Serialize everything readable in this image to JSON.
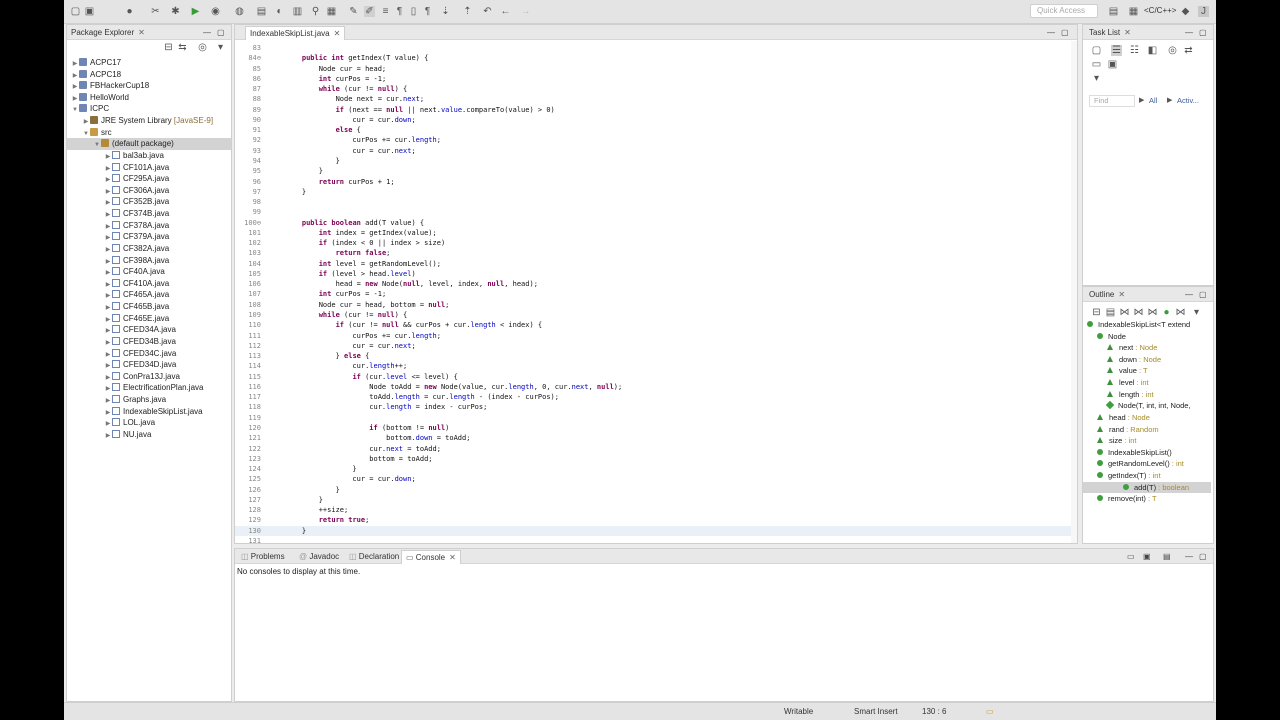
{
  "toolbar": {
    "quick_access_placeholder": "Quick Access",
    "perspective_label": "<C/C++>"
  },
  "package_explorer": {
    "tab_label": "Package Explorer",
    "tree": [
      {
        "label": "ACPC17",
        "level": 0,
        "icon": "project",
        "expander": "collapsed"
      },
      {
        "label": "ACPC18",
        "level": 0,
        "icon": "project",
        "expander": "collapsed"
      },
      {
        "label": "FBHackerCup18",
        "level": 0,
        "icon": "project",
        "expander": "collapsed"
      },
      {
        "label": "HelloWorld",
        "level": 0,
        "icon": "project",
        "expander": "collapsed"
      },
      {
        "label": "ICPC",
        "level": 0,
        "icon": "project",
        "expander": "expanded"
      },
      {
        "label": "JRE System Library",
        "extra": "[JavaSE-9]",
        "level": 1,
        "icon": "lib",
        "expander": "collapsed"
      },
      {
        "label": "src",
        "level": 1,
        "icon": "src",
        "expander": "expanded"
      },
      {
        "label": "(default package)",
        "level": 2,
        "icon": "pkg",
        "expander": "expanded",
        "selected": true
      },
      {
        "label": "bal3ab.java",
        "level": 3,
        "icon": "java",
        "expander": "collapsed"
      },
      {
        "label": "CF101A.java",
        "level": 3,
        "icon": "java",
        "expander": "collapsed"
      },
      {
        "label": "CF295A.java",
        "level": 3,
        "icon": "java",
        "expander": "collapsed"
      },
      {
        "label": "CF306A.java",
        "level": 3,
        "icon": "java",
        "expander": "collapsed"
      },
      {
        "label": "CF352B.java",
        "level": 3,
        "icon": "java",
        "expander": "collapsed"
      },
      {
        "label": "CF374B.java",
        "level": 3,
        "icon": "java",
        "expander": "collapsed"
      },
      {
        "label": "CF378A.java",
        "level": 3,
        "icon": "java",
        "expander": "collapsed"
      },
      {
        "label": "CF379A.java",
        "level": 3,
        "icon": "java",
        "expander": "collapsed"
      },
      {
        "label": "CF382A.java",
        "level": 3,
        "icon": "java",
        "expander": "collapsed"
      },
      {
        "label": "CF398A.java",
        "level": 3,
        "icon": "java",
        "expander": "collapsed"
      },
      {
        "label": "CF40A.java",
        "level": 3,
        "icon": "java",
        "expander": "collapsed"
      },
      {
        "label": "CF410A.java",
        "level": 3,
        "icon": "java",
        "expander": "collapsed"
      },
      {
        "label": "CF465A.java",
        "level": 3,
        "icon": "java",
        "expander": "collapsed"
      },
      {
        "label": "CF465B.java",
        "level": 3,
        "icon": "java",
        "expander": "collapsed"
      },
      {
        "label": "CF465E.java",
        "level": 3,
        "icon": "java",
        "expander": "collapsed"
      },
      {
        "label": "CFED34A.java",
        "level": 3,
        "icon": "java",
        "expander": "collapsed"
      },
      {
        "label": "CFED34B.java",
        "level": 3,
        "icon": "java",
        "expander": "collapsed"
      },
      {
        "label": "CFED34C.java",
        "level": 3,
        "icon": "java",
        "expander": "collapsed"
      },
      {
        "label": "CFED34D.java",
        "level": 3,
        "icon": "java",
        "expander": "collapsed"
      },
      {
        "label": "ConPra13J.java",
        "level": 3,
        "icon": "java",
        "expander": "collapsed"
      },
      {
        "label": "ElectrificationPlan.java",
        "level": 3,
        "icon": "java",
        "expander": "collapsed"
      },
      {
        "label": "Graphs.java",
        "level": 3,
        "icon": "java",
        "expander": "collapsed"
      },
      {
        "label": "IndexableSkipList.java",
        "level": 3,
        "icon": "java",
        "expander": "collapsed"
      },
      {
        "label": "LOL.java",
        "level": 3,
        "icon": "java",
        "expander": "collapsed"
      },
      {
        "label": "NU.java",
        "level": 3,
        "icon": "java",
        "expander": "collapsed"
      }
    ]
  },
  "editor": {
    "tab_label": "IndexableSkipList.java",
    "lines": [
      {
        "n": "83",
        "code": ""
      },
      {
        "n": "84⊖",
        "code": "    public int getIndex(T value) {"
      },
      {
        "n": "85",
        "code": "        Node cur = head;"
      },
      {
        "n": "86",
        "code": "        int curPos = -1;"
      },
      {
        "n": "87",
        "code": "        while (cur != null) {"
      },
      {
        "n": "88",
        "code": "            Node next = cur.next;"
      },
      {
        "n": "89",
        "code": "            if (next == null || next.value.compareTo(value) > 0)"
      },
      {
        "n": "90",
        "code": "                cur = cur.down;"
      },
      {
        "n": "91",
        "code": "            else {"
      },
      {
        "n": "92",
        "code": "                curPos += cur.length;"
      },
      {
        "n": "93",
        "code": "                cur = cur.next;"
      },
      {
        "n": "94",
        "code": "            }"
      },
      {
        "n": "95",
        "code": "        }"
      },
      {
        "n": "96",
        "code": "        return curPos + 1;"
      },
      {
        "n": "97",
        "code": "    }"
      },
      {
        "n": "98",
        "code": ""
      },
      {
        "n": "99",
        "code": ""
      },
      {
        "n": "100⊖",
        "code": "    public boolean add(T value) {"
      },
      {
        "n": "101",
        "code": "        int index = getIndex(value);"
      },
      {
        "n": "102",
        "code": "        if (index < 0 || index > size)"
      },
      {
        "n": "103",
        "code": "            return false;"
      },
      {
        "n": "104",
        "code": "        int level = getRandomLevel();"
      },
      {
        "n": "105",
        "code": "        if (level > head.level)"
      },
      {
        "n": "106",
        "code": "            head = new Node(null, level, index, null, head);"
      },
      {
        "n": "107",
        "code": "        int curPos = -1;"
      },
      {
        "n": "108",
        "code": "        Node cur = head, bottom = null;"
      },
      {
        "n": "109",
        "code": "        while (cur != null) {"
      },
      {
        "n": "110",
        "code": "            if (cur != null && curPos + cur.length < index) {"
      },
      {
        "n": "111",
        "code": "                curPos += cur.length;"
      },
      {
        "n": "112",
        "code": "                cur = cur.next;"
      },
      {
        "n": "113",
        "code": "            } else {"
      },
      {
        "n": "114",
        "code": "                cur.length++;"
      },
      {
        "n": "115",
        "code": "                if (cur.level <= level) {"
      },
      {
        "n": "116",
        "code": "                    Node toAdd = new Node(value, cur.length, 0, cur.next, null);"
      },
      {
        "n": "117",
        "code": "                    toAdd.length = cur.length - (index - curPos);"
      },
      {
        "n": "118",
        "code": "                    cur.length = index - curPos;"
      },
      {
        "n": "119",
        "code": ""
      },
      {
        "n": "120",
        "code": "                    if (bottom != null)"
      },
      {
        "n": "121",
        "code": "                        bottom.down = toAdd;"
      },
      {
        "n": "122",
        "code": "                    cur.next = toAdd;"
      },
      {
        "n": "123",
        "code": "                    bottom = toAdd;"
      },
      {
        "n": "124",
        "code": "                }"
      },
      {
        "n": "125",
        "code": "                cur = cur.down;"
      },
      {
        "n": "126",
        "code": "            }"
      },
      {
        "n": "127",
        "code": "        }"
      },
      {
        "n": "128",
        "code": "        ++size;"
      },
      {
        "n": "129",
        "code": "        return true;"
      },
      {
        "n": "130",
        "code": "    }"
      },
      {
        "n": "131",
        "code": ""
      }
    ]
  },
  "task_list": {
    "tab_label": "Task List",
    "find_placeholder": "Find",
    "all_label": "All",
    "activate_label": "Activ..."
  },
  "outline": {
    "tab_label": "Outline",
    "items": [
      {
        "label": "IndexableSkipList<T extend",
        "type": "",
        "level": 0,
        "kind": "class"
      },
      {
        "label": "Node",
        "type": "",
        "level": 1,
        "kind": "class"
      },
      {
        "label": "next",
        "type": " : Node",
        "level": 2,
        "kind": "field"
      },
      {
        "label": "down",
        "type": " : Node",
        "level": 2,
        "kind": "field"
      },
      {
        "label": "value",
        "type": " : T",
        "level": 2,
        "kind": "field"
      },
      {
        "label": "level",
        "type": " : int",
        "level": 2,
        "kind": "field"
      },
      {
        "label": "length",
        "type": " : int",
        "level": 2,
        "kind": "field"
      },
      {
        "label": "Node(T, int, int, Node,",
        "type": "",
        "level": 2,
        "kind": "constructor"
      },
      {
        "label": "head",
        "type": " : Node",
        "level": 1,
        "kind": "field"
      },
      {
        "label": "rand",
        "type": " : Random",
        "level": 1,
        "kind": "field"
      },
      {
        "label": "size",
        "type": " : int",
        "level": 1,
        "kind": "field"
      },
      {
        "label": "IndexableSkipList()",
        "type": "",
        "level": 1,
        "kind": "method"
      },
      {
        "label": "getRandomLevel()",
        "type": " : int",
        "level": 1,
        "kind": "method"
      },
      {
        "label": "getIndex(T)",
        "type": " : int",
        "level": 1,
        "kind": "method"
      },
      {
        "label": "add(T)",
        "type": " : boolean",
        "level": 1,
        "kind": "method",
        "selected": true
      },
      {
        "label": "remove(int)",
        "type": " : T",
        "level": 1,
        "kind": "method"
      }
    ]
  },
  "bottom": {
    "tabs": [
      "Problems",
      "Javadoc",
      "Declaration",
      "Console"
    ],
    "active_tab": "Console",
    "console_message": "No consoles to display at this time."
  },
  "status": {
    "writable": "Writable",
    "insert_mode": "Smart Insert",
    "position": "130 : 6"
  }
}
